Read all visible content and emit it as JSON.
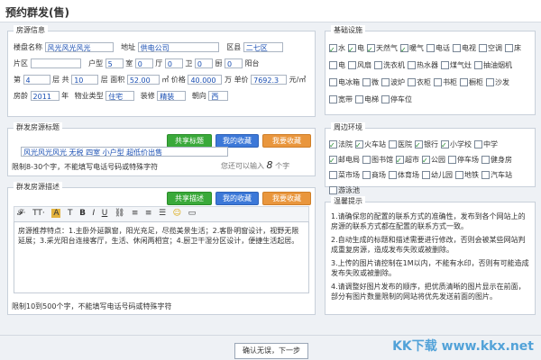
{
  "title": "预约群发(售)",
  "info": {
    "legend": "房源信息",
    "estate_label": "楼盘名称",
    "estate_value": "风光风光风光",
    "address_label": "地址",
    "address_value": "供电公司",
    "district_label": "区县",
    "district_value": "二七区",
    "area_label": "片区",
    "layout": {
      "shi_label": "户型",
      "shi_value": "5",
      "shi_unit": "室",
      "ting_value": "0",
      "ting_unit": "厅",
      "wei_value": "0",
      "wei_unit": "卫",
      "chu_value": "0",
      "chu_unit": "厨",
      "tai_value": "0",
      "tai_unit": "阳台"
    },
    "floor_label": "第",
    "floor_value": "4",
    "floor_unit": "层",
    "total_floor_label": "共",
    "total_floor_value": "10",
    "total_floor_unit": "层",
    "area2_label": "面积",
    "area2_value": "52.00",
    "area2_unit": "㎡",
    "price_label": "价格",
    "price_value": "40.000",
    "price_unit": "万",
    "unit_label": "单价",
    "unit_value": "7692.3",
    "unit_unit": "元/㎡",
    "age_label": "房龄",
    "age_value": "2011",
    "age_unit": "年",
    "type_label": "物业类型",
    "type_value": "住宅",
    "decor_label": "装修",
    "decor_value": "精装",
    "orient_label": "朝向",
    "orient_value": "西"
  },
  "headline": {
    "legend": "群发房源标题",
    "value": "风光风光风光 无税 四室 小户型 超低价出售",
    "share_button": "共享标题",
    "fav_button": "我的收藏",
    "myfav_button": "我要收藏",
    "rule": "限制8-30个字，不能填写电话号码或特殊字符",
    "remaining": "您还可以输入",
    "remaining_count": "8",
    "remaining_unit": "个字"
  },
  "desc": {
    "legend": "群发房源描述",
    "share_button": "共享描述",
    "fav_button": "我的收藏",
    "myfav_button": "我要收藏",
    "text": "房源推荐特点：1.主卧外延飘窗，阳光充足，尽揽美景生活；2.客卧明窗设计，视野无限延展；3.采光阳台连接客厅，生活、休闲两相宜；4.厨卫干湿分区设计，便捷生活起居。",
    "rule": "限制10到500个字，不能填写电话号码或特殊字符"
  },
  "facilities": {
    "legend": "基础设施",
    "items": [
      {
        "label": "水",
        "checked": true
      },
      {
        "label": "电",
        "checked": true
      },
      {
        "label": "天然气",
        "checked": true
      },
      {
        "label": "暖气",
        "checked": true
      },
      {
        "label": "电话",
        "checked": false
      },
      {
        "label": "电视",
        "checked": false
      },
      {
        "label": "空调",
        "checked": false
      },
      {
        "label": "床",
        "checked": false
      },
      {
        "label": "电",
        "checked": false
      },
      {
        "label": "风扇",
        "checked": false
      },
      {
        "label": "洗衣机",
        "checked": false
      },
      {
        "label": "热水器",
        "checked": false
      },
      {
        "label": "煤气灶",
        "checked": false
      },
      {
        "label": "抽油烟机",
        "checked": false
      },
      {
        "label": "电冰箱",
        "checked": false
      },
      {
        "label": "微",
        "checked": false
      },
      {
        "label": "波炉",
        "checked": false
      },
      {
        "label": "衣柜",
        "checked": false
      },
      {
        "label": "书柜",
        "checked": false
      },
      {
        "label": "橱柜",
        "checked": false
      },
      {
        "label": "沙发",
        "checked": false
      },
      {
        "label": "宽带",
        "checked": false
      },
      {
        "label": "电梯",
        "checked": false
      },
      {
        "label": "停车位",
        "checked": false
      }
    ]
  },
  "surroundings": {
    "legend": "周边环境",
    "items": [
      {
        "label": "法院",
        "checked": true
      },
      {
        "label": "火车站",
        "checked": true
      },
      {
        "label": "医院",
        "checked": false
      },
      {
        "label": "银行",
        "checked": true
      },
      {
        "label": "小学校",
        "checked": true
      },
      {
        "label": "中学",
        "checked": false
      },
      {
        "label": "邮电局",
        "checked": true
      },
      {
        "label": "图书馆",
        "checked": false
      },
      {
        "label": "超市",
        "checked": true
      },
      {
        "label": "公园",
        "checked": true
      },
      {
        "label": "停车场",
        "checked": false
      },
      {
        "label": "健身房",
        "checked": false
      },
      {
        "label": "菜市场",
        "checked": false
      },
      {
        "label": "商场",
        "checked": false
      },
      {
        "label": "体育场",
        "checked": false
      },
      {
        "label": "幼儿园",
        "checked": false
      },
      {
        "label": "地铁",
        "checked": false
      },
      {
        "label": "汽车站",
        "checked": false
      },
      {
        "label": "游泳池",
        "checked": false
      }
    ]
  },
  "tips": {
    "legend": "温馨提示",
    "lines": [
      "1.请确保您的配置的联系方式的准确性，发布到各个网站上的房源的联系方式都在配置的联系方式一致。",
      "2.自动生成的标题和描述需要进行修改，否则会被某些网站判成重复房源，造成发布失败或被删除。",
      "3.上传的图片请控制在1M以内，不能有水印，否则有可能造成发布失败或被删除。",
      "4.请调整好图片发布的顺序，把优质清晰的图片显示在前面，部分有图片数量限制的网站将优先发送前面的图片。"
    ]
  },
  "submit": "确认无误，下一步",
  "watermark": "KK下载 www.kkx.net"
}
